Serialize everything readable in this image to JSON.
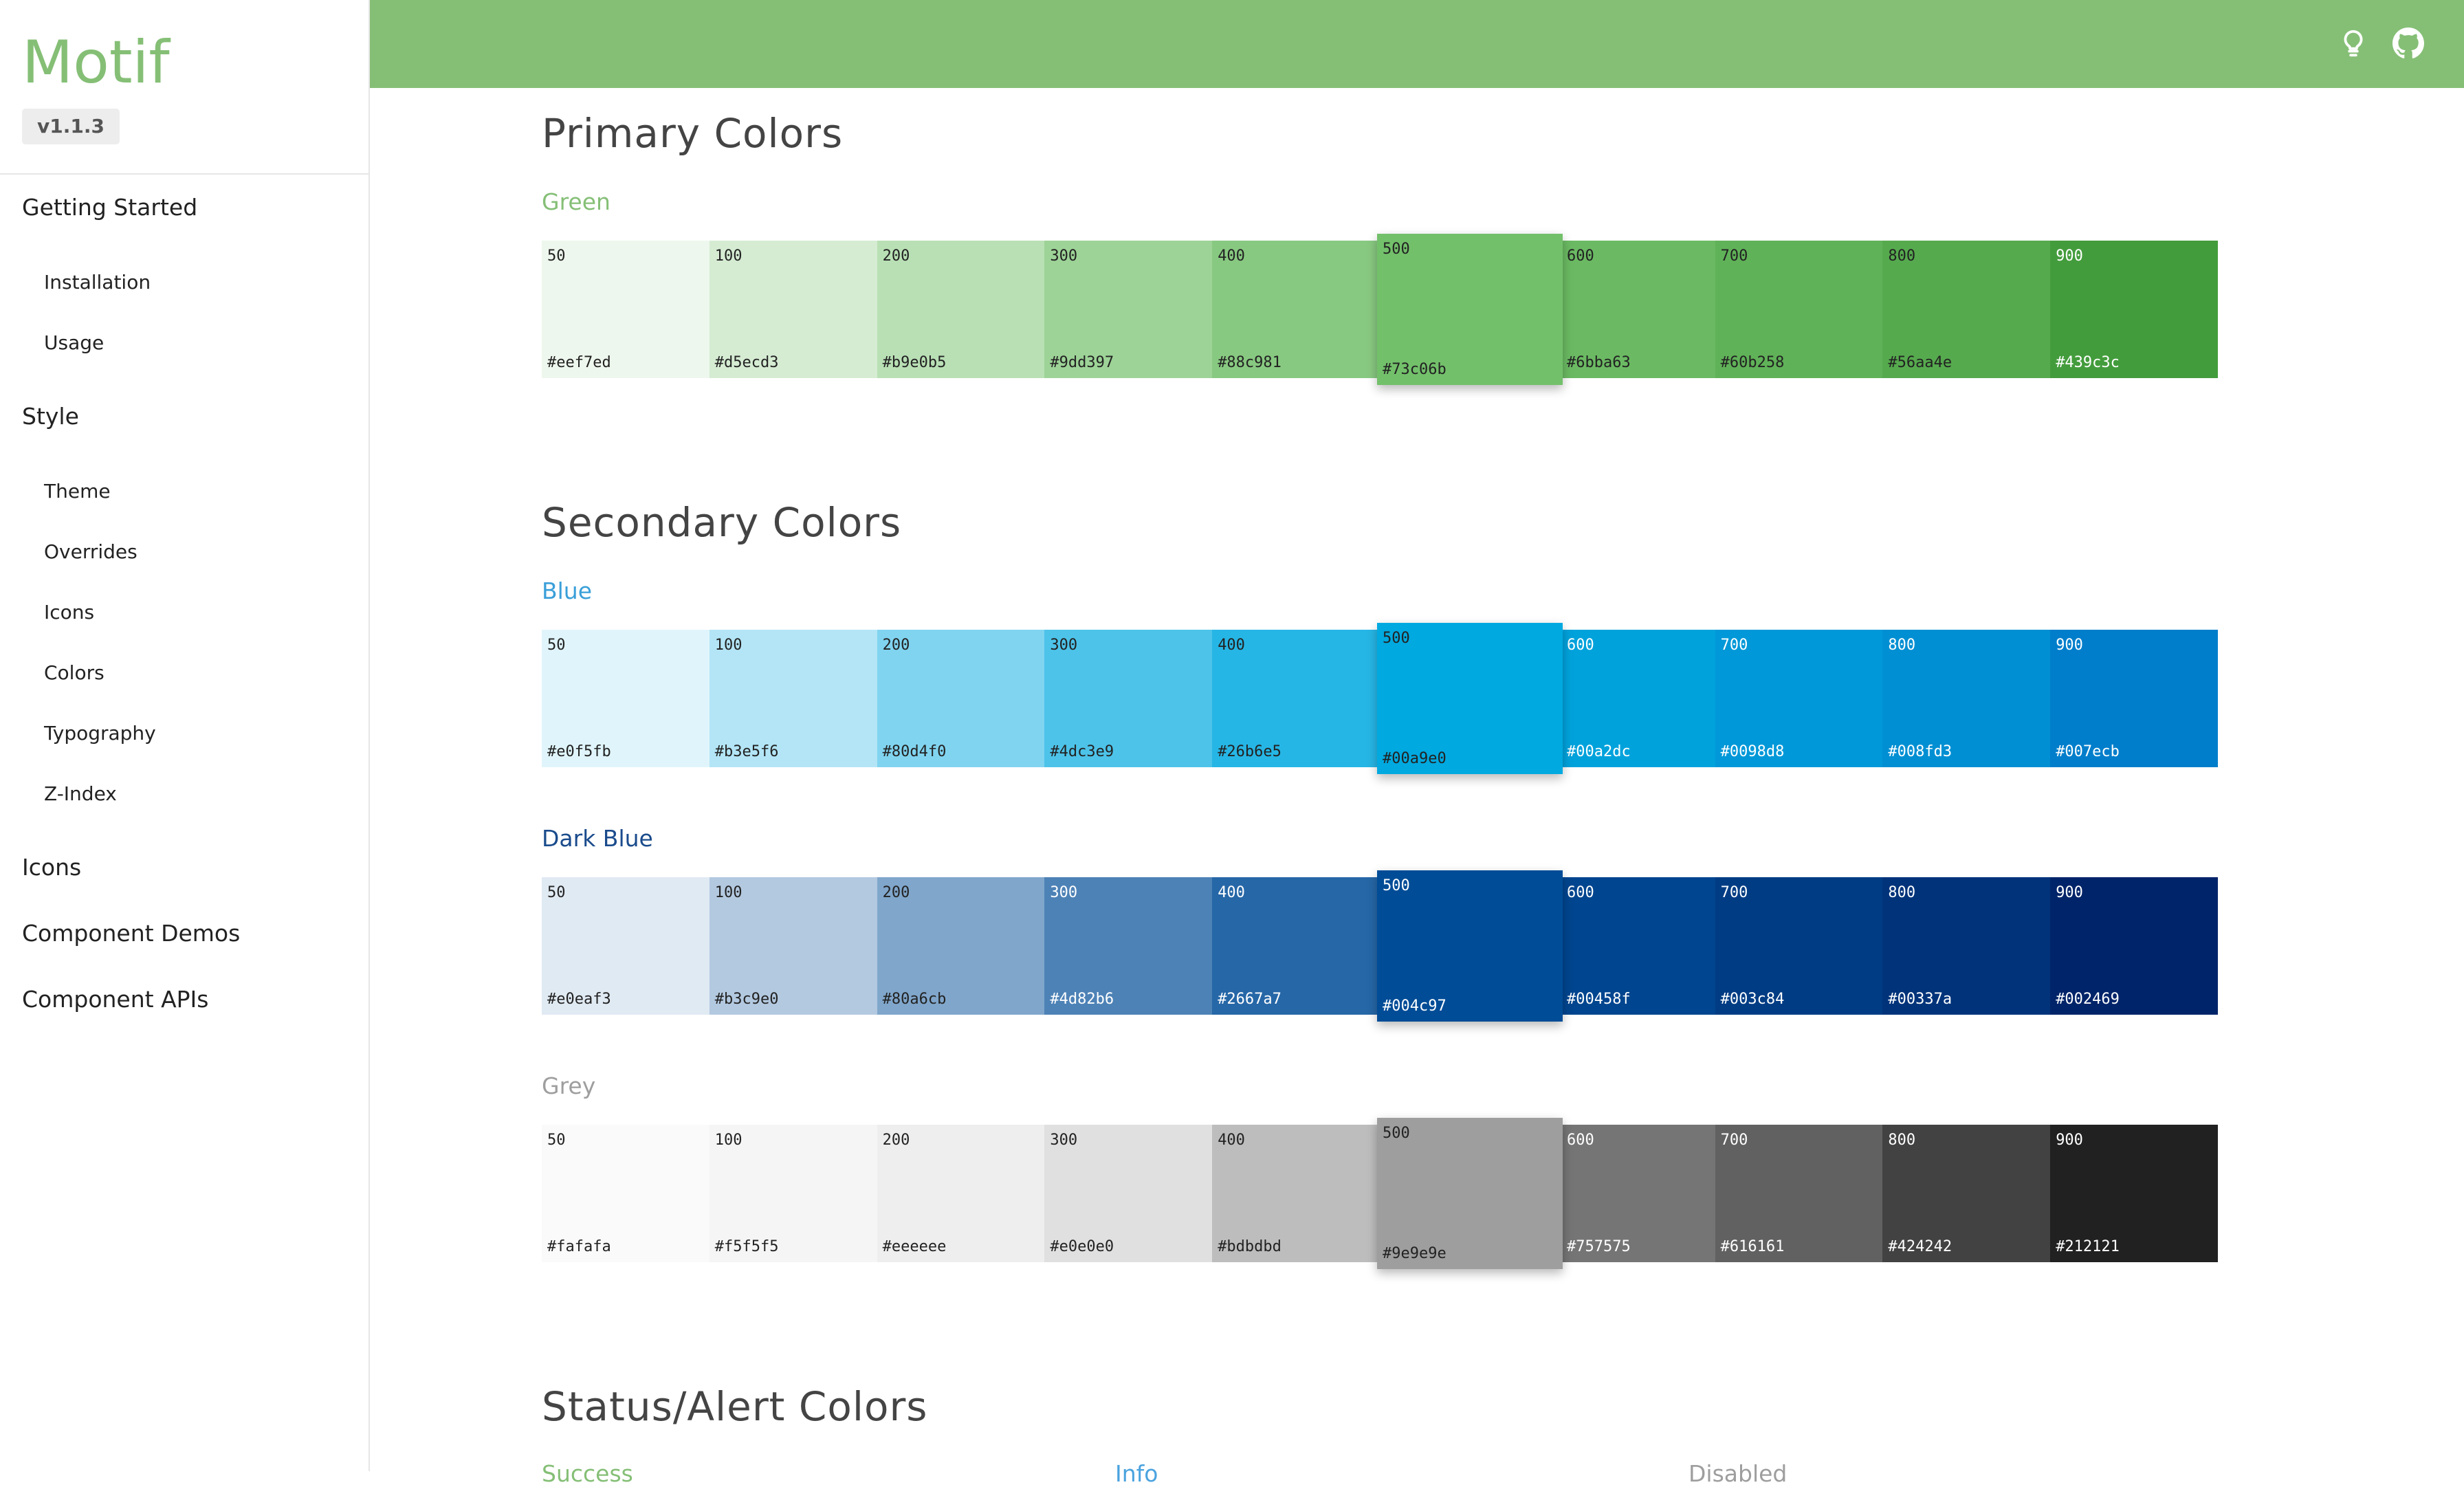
{
  "brand": {
    "title": "Motif",
    "version": "v1.1.3",
    "accent": "#85bf76"
  },
  "header": {
    "bar_color": "#85bf76",
    "icons": [
      "lightbulb-icon",
      "github-icon"
    ]
  },
  "nav": {
    "getting_started": "Getting Started",
    "installation": "Installation",
    "usage": "Usage",
    "style": "Style",
    "theme": "Theme",
    "overrides": "Overrides",
    "icons_sub": "Icons",
    "colors": "Colors",
    "typography": "Typography",
    "zindex": "Z-Index",
    "icons": "Icons",
    "component_demos": "Component Demos",
    "component_apis": "Component APIs"
  },
  "sections": {
    "primary": "Primary Colors",
    "secondary": "Secondary Colors",
    "status": "Status/Alert Colors"
  },
  "status_labels": [
    {
      "text": "Success",
      "color": "#85bf76"
    },
    {
      "text": "Info",
      "color": "#4aa3df"
    },
    {
      "text": "Disabled",
      "color": "#9e9e9e"
    }
  ],
  "palettes": {
    "green": {
      "name": "Green",
      "label_color": "#85bf76",
      "swatches": [
        {
          "step": "50",
          "hex": "#eef7ed",
          "bg": "#eef7ed",
          "text": "#222222"
        },
        {
          "step": "100",
          "hex": "#d5ecd3",
          "bg": "#d5ecd3",
          "text": "#222222"
        },
        {
          "step": "200",
          "hex": "#b9e0b5",
          "bg": "#b9e0b5",
          "text": "#222222"
        },
        {
          "step": "300",
          "hex": "#9dd397",
          "bg": "#9dd397",
          "text": "#222222"
        },
        {
          "step": "400",
          "hex": "#88c981",
          "bg": "#88c981",
          "text": "#222222"
        },
        {
          "step": "500",
          "hex": "#73c06b",
          "bg": "#73c06b",
          "text": "#222222"
        },
        {
          "step": "600",
          "hex": "#6bba63",
          "bg": "#6bba63",
          "text": "#222222"
        },
        {
          "step": "700",
          "hex": "#60b258",
          "bg": "#60b258",
          "text": "#222222"
        },
        {
          "step": "800",
          "hex": "#56aa4e",
          "bg": "#56aa4e",
          "text": "#222222"
        },
        {
          "step": "900",
          "hex": "#439c3c",
          "bg": "#439c3c",
          "text": "#ffffff"
        }
      ]
    },
    "blue": {
      "name": "Blue",
      "label_color": "#3a9fd9",
      "swatches": [
        {
          "step": "50",
          "hex": "#e0f5fb",
          "bg": "#e0f5fb",
          "text": "#222222"
        },
        {
          "step": "100",
          "hex": "#b3e5f6",
          "bg": "#b3e5f6",
          "text": "#222222"
        },
        {
          "step": "200",
          "hex": "#80d4f0",
          "bg": "#80d4f0",
          "text": "#222222"
        },
        {
          "step": "300",
          "hex": "#4dc3e9",
          "bg": "#4dc3e9",
          "text": "#222222"
        },
        {
          "step": "400",
          "hex": "#26b6e5",
          "bg": "#26b6e5",
          "text": "#222222"
        },
        {
          "step": "500",
          "hex": "#00a9e0",
          "bg": "#00a9e0",
          "text": "#222222"
        },
        {
          "step": "600",
          "hex": "#00a2dc",
          "bg": "#00a2dc",
          "text": "#ffffff"
        },
        {
          "step": "700",
          "hex": "#0098d8",
          "bg": "#0098d8",
          "text": "#ffffff"
        },
        {
          "step": "800",
          "hex": "#008fd3",
          "bg": "#008fd3",
          "text": "#ffffff"
        },
        {
          "step": "900",
          "hex": "#007ecb",
          "bg": "#007ecb",
          "text": "#ffffff"
        }
      ]
    },
    "darkblue": {
      "name": "Dark Blue",
      "label_color": "#1a4b8c",
      "swatches": [
        {
          "step": "50",
          "hex": "#e0eaf3",
          "bg": "#e0eaf3",
          "text": "#222222"
        },
        {
          "step": "100",
          "hex": "#b3c9e0",
          "bg": "#b3c9e0",
          "text": "#222222"
        },
        {
          "step": "200",
          "hex": "#80a6cb",
          "bg": "#80a6cb",
          "text": "#222222"
        },
        {
          "step": "300",
          "hex": "#4d82b6",
          "bg": "#4d82b6",
          "text": "#ffffff"
        },
        {
          "step": "400",
          "hex": "#2667a7",
          "bg": "#2667a7",
          "text": "#ffffff"
        },
        {
          "step": "500",
          "hex": "#004c97",
          "bg": "#004c97",
          "text": "#ffffff"
        },
        {
          "step": "600",
          "hex": "#00458f",
          "bg": "#00458f",
          "text": "#ffffff"
        },
        {
          "step": "700",
          "hex": "#003c84",
          "bg": "#003c84",
          "text": "#ffffff"
        },
        {
          "step": "800",
          "hex": "#00337a",
          "bg": "#00337a",
          "text": "#ffffff"
        },
        {
          "step": "900",
          "hex": "#002469",
          "bg": "#002469",
          "text": "#ffffff"
        }
      ]
    },
    "grey": {
      "name": "Grey",
      "label_color": "#9e9e9e",
      "swatches": [
        {
          "step": "50",
          "hex": "#fafafa",
          "bg": "#fafafa",
          "text": "#222222"
        },
        {
          "step": "100",
          "hex": "#f5f5f5",
          "bg": "#f5f5f5",
          "text": "#222222"
        },
        {
          "step": "200",
          "hex": "#eeeeee",
          "bg": "#eeeeee",
          "text": "#222222"
        },
        {
          "step": "300",
          "hex": "#e0e0e0",
          "bg": "#e0e0e0",
          "text": "#222222"
        },
        {
          "step": "400",
          "hex": "#bdbdbd",
          "bg": "#bdbdbd",
          "text": "#222222"
        },
        {
          "step": "500",
          "hex": "#9e9e9e",
          "bg": "#9e9e9e",
          "text": "#222222"
        },
        {
          "step": "600",
          "hex": "#757575",
          "bg": "#757575",
          "text": "#ffffff"
        },
        {
          "step": "700",
          "hex": "#616161",
          "bg": "#616161",
          "text": "#ffffff"
        },
        {
          "step": "800",
          "hex": "#424242",
          "bg": "#424242",
          "text": "#ffffff"
        },
        {
          "step": "900",
          "hex": "#212121",
          "bg": "#212121",
          "text": "#ffffff"
        }
      ]
    }
  }
}
